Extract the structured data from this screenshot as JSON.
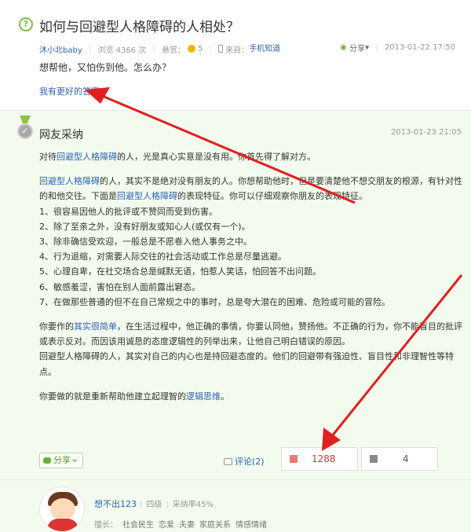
{
  "question": {
    "icon": "question-mark-icon",
    "icon_glyph": "?",
    "title": "如何与回避型人格障碍的人相处？",
    "author": "沐小北baby",
    "views": "浏览 4366 次",
    "reward_label": "悬赏：",
    "reward_value": "5",
    "source_label": "来自：",
    "source": "手机知道",
    "share": "分享",
    "date": "2013-01-22 17:50",
    "body": "想帮他，又怕伤到他。怎么办？",
    "better_answer": "我有更好的答案"
  },
  "answer": {
    "badge_icon": "medal-icon",
    "badge_glyph": "✓",
    "label": "网友采纳",
    "date": "2013-01-23 21:05",
    "p1_a": "对待",
    "p1_link": "回避型人格障碍",
    "p1_b": "的人，光是真心实意是没有用。你首先得了解对方。",
    "p2_link": "回避型人格障碍",
    "p2_a": "的人，其实不是绝对没有朋友的人。你想帮助他时，但是要清楚他不想交朋友的根源，有针对性的和他交往。下面是",
    "p2_link2": "回避型人格障碍",
    "p2_b": "的表现特征。你可以仔细观察你朋友的表现特征。",
    "list": [
      "1、很容易因他人的批评或不赞同而受到伤害。",
      "2、除了至亲之外，没有好朋友或知心人(或仅有一个)。",
      "3、除非确信受欢迎，一般总是不愿卷入他人事务之中。",
      "4、行为退缩，对需要人际交往的社会活动或工作总是尽量逃避。",
      "5、心理自卑，在社交场合总是缄默无语，怕惹人笑话，怕回答不出问题。",
      "6、敏感羞涩，害怕在别人面前露出窘态。",
      "7、在做那些普通的但不在自己常规之中的事时，总是夸大潜在的困难、危险或可能的冒险。"
    ],
    "p3_a": "你要作的",
    "p3_link": "其实很简单",
    "p3_b": "，在生活过程中，他正确的事情，你要认同他，赞扬他。不正确的行为，你不能盲目的批评或表示反对。而因该用诚恳的态度逻辑性的列举出来，让他自己明白错误的原因。",
    "p4": "回避型人格障碍的人，其实对自己的内心也是持回避态度的。他们的回避带有强迫性、盲目性和非理智性等特点。",
    "p5_a": "你要做的就是重新帮助他建立起理智的",
    "p5_link": "逻辑思维",
    "p5_b": "。",
    "share": "分享",
    "comment": "评论(2)",
    "upvotes": "1288",
    "downvotes": "4"
  },
  "user": {
    "name": "想不出123",
    "level": "四级",
    "accept_rate": "采纳率45%",
    "expertise_label": "擅长：",
    "expertise": [
      "社会民生",
      "恋爱",
      "夫妻",
      "家庭关系",
      "情感情绪"
    ]
  }
}
